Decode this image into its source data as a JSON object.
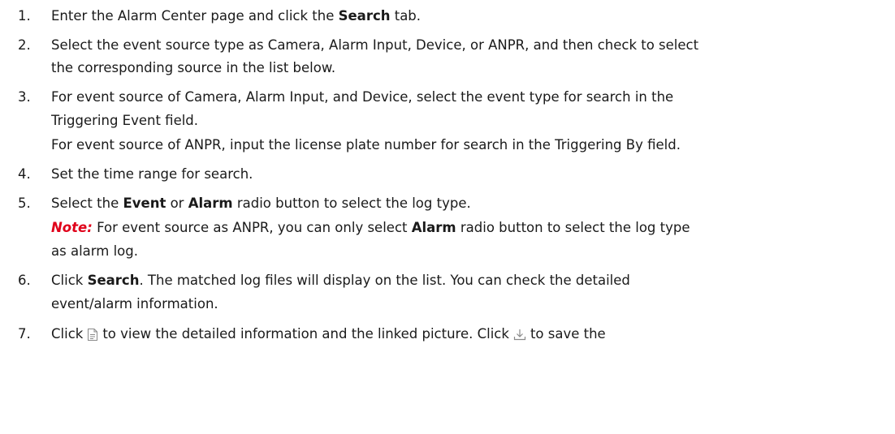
{
  "steps": [
    {
      "number": "1.",
      "lines": [
        {
          "a": "Enter the Alarm Center page and click the ",
          "b": "Search",
          "c": " tab."
        }
      ]
    },
    {
      "number": "2.",
      "lines": [
        {
          "a": "Select the event source type as Camera, Alarm Input, Device, or ANPR, and then check to select"
        },
        {
          "a": "the corresponding source in the list below."
        }
      ]
    },
    {
      "number": "3.",
      "lines": [
        {
          "a": "For event source of Camera, Alarm Input, and Device, select the event type for search in the"
        },
        {
          "a": "Triggering Event field."
        },
        {
          "a": "For event source of ANPR, input the license plate number for search in the Triggering By field."
        }
      ]
    },
    {
      "number": "4.",
      "lines": [
        {
          "a": "Set the time range for search."
        }
      ]
    },
    {
      "number": "5.",
      "lines": [
        {
          "a": "Select the ",
          "b": "Event",
          "c": " or ",
          "d": "Alarm",
          "e": " radio button to select the log type."
        },
        {
          "note": "Note:",
          "a": " For event source as ANPR, you can only select ",
          "b": "Alarm",
          "c": " radio button to select the log type"
        },
        {
          "a": "as alarm log."
        }
      ]
    },
    {
      "number": "6.",
      "lines": [
        {
          "a": "Click ",
          "b": "Search",
          "c": ". The matched log files will display on the list. You can check the detailed"
        },
        {
          "a": "event/alarm information."
        }
      ]
    },
    {
      "number": "7.",
      "lines": [
        {
          "a": "Click",
          "icon1": "document-icon",
          "b": "to view the detailed information and the linked picture. Click",
          "icon2": "download-icon",
          "c": "to save the"
        }
      ]
    }
  ]
}
